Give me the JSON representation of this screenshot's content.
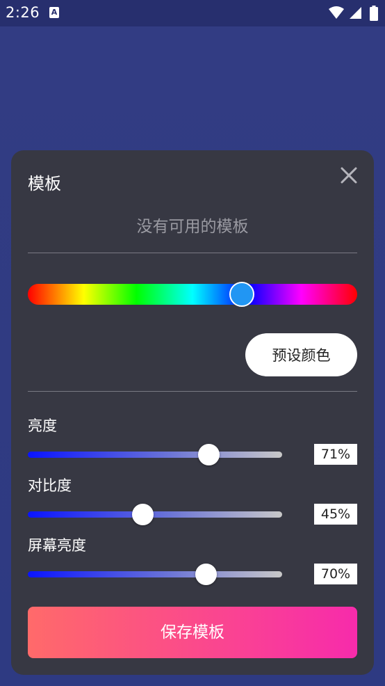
{
  "status_bar": {
    "time": "2:26",
    "notification_icon": "a-icon",
    "icons": [
      "wifi-icon",
      "signal-icon",
      "battery-icon"
    ]
  },
  "panel": {
    "title": "模板",
    "close_icon": "close-icon",
    "empty_message": "没有可用的模板",
    "hue": {
      "value": 0.65
    },
    "preset_button": "预设颜色",
    "sliders": [
      {
        "label": "亮度",
        "value": 0.71,
        "display": "71%"
      },
      {
        "label": "对比度",
        "value": 0.45,
        "display": "45%"
      },
      {
        "label": "屏幕亮度",
        "value": 0.7,
        "display": "70%"
      }
    ],
    "save_button": "保存模板"
  },
  "colors": {
    "background": "#2f3a80",
    "panel": "#373843",
    "hue_thumb": "#2196f3",
    "save_gradient_start": "#ff6a6a",
    "save_gradient_end": "#f72bab"
  }
}
